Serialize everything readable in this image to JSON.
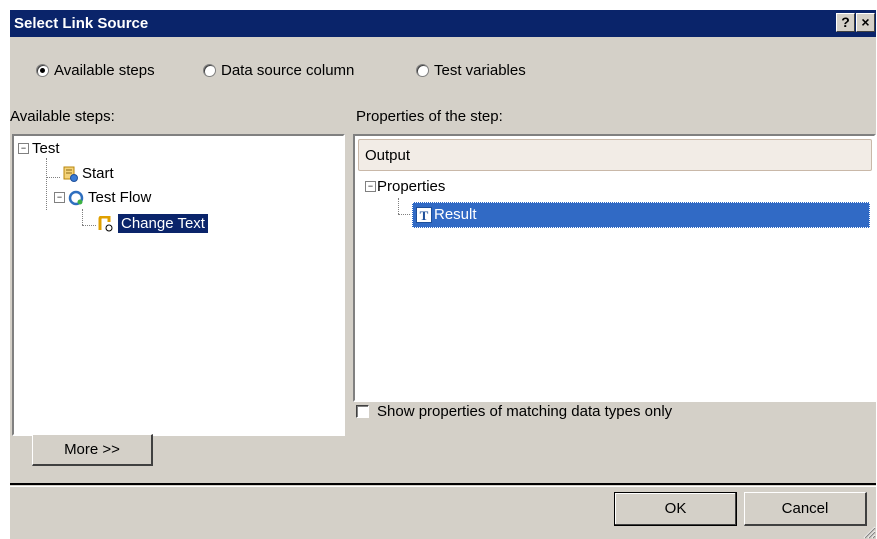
{
  "dialog": {
    "title": "Select Link Source",
    "help_button": "?",
    "close_button": "×"
  },
  "source_options": [
    {
      "label": "Available steps",
      "checked": true
    },
    {
      "label": "Data source column",
      "checked": false
    },
    {
      "label": "Test variables",
      "checked": false
    }
  ],
  "left_panel": {
    "heading": "Available steps:",
    "tree": {
      "root": "Test",
      "children": [
        "Start",
        "Test Flow"
      ],
      "grandchild": "Change Text"
    }
  },
  "right_panel": {
    "heading": "Properties of the step:",
    "grid_header": "Output",
    "properties_node": "Properties",
    "result_node": "Result"
  },
  "filter_checkbox": {
    "label": "Show properties of matching data types only",
    "checked": false
  },
  "buttons": {
    "more": "More >>",
    "ok": "OK",
    "cancel": "Cancel"
  },
  "expander": {
    "collapse": "−"
  }
}
